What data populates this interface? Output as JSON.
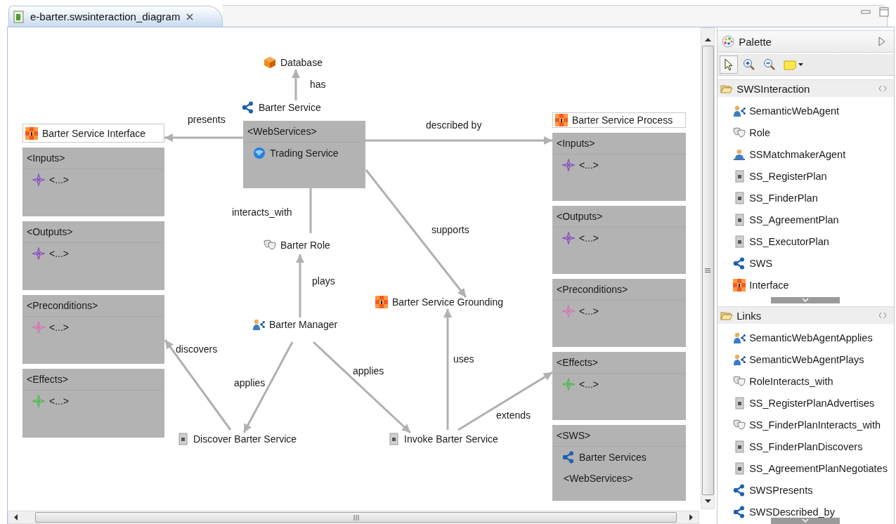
{
  "editor_tab": {
    "title": "e-barter.swsinteraction_diagram",
    "selected": true
  },
  "diagram": {
    "nodes": [
      {
        "kind": "database",
        "label": "Database"
      },
      {
        "kind": "sws",
        "label": "Barter Service"
      },
      {
        "kind": "role",
        "label": "Barter Role"
      },
      {
        "kind": "agent",
        "label": "Barter Manager"
      },
      {
        "kind": "grounding",
        "label": "Barter Service Grounding"
      },
      {
        "kind": "plan",
        "label": "Discover Barter Service"
      },
      {
        "kind": "plan",
        "label": "Invoke Barter Service"
      }
    ],
    "boxes": [
      {
        "kind": "interface",
        "title": "Barter Service Interface",
        "sections": [
          {
            "title": "<Inputs>",
            "items": [
              {
                "kind": "param",
                "label": "<...>",
                "color": "#8a4fc0"
              }
            ]
          },
          {
            "title": "<Outputs>",
            "items": [
              {
                "kind": "param",
                "label": "<...>",
                "color": "#8a4fc0"
              }
            ]
          },
          {
            "title": "<Preconditions>",
            "items": [
              {
                "kind": "param",
                "label": "<...>",
                "color": "#d774b4"
              }
            ]
          },
          {
            "title": "<Effects>",
            "items": [
              {
                "kind": "param",
                "label": "<...>",
                "color": "#4fb84f"
              }
            ]
          }
        ]
      },
      {
        "kind": "webservices",
        "sections": [
          {
            "title": "<WebServices>",
            "items": [
              {
                "kind": "globe",
                "label": "Trading Service"
              }
            ]
          }
        ]
      },
      {
        "kind": "process",
        "title": "Barter Service Process",
        "sections": [
          {
            "title": "<Inputs>",
            "items": [
              {
                "kind": "param",
                "label": "<...>",
                "color": "#8a4fc0"
              }
            ]
          },
          {
            "title": "<Outputs>",
            "items": [
              {
                "kind": "param",
                "label": "<...>",
                "color": "#8a4fc0"
              }
            ]
          },
          {
            "title": "<Preconditions>",
            "items": [
              {
                "kind": "param",
                "label": "<...>",
                "color": "#d774b4"
              }
            ]
          },
          {
            "title": "<Effects>",
            "items": [
              {
                "kind": "param",
                "label": "<...>",
                "color": "#4fb84f"
              }
            ]
          },
          {
            "title": "<SWS>",
            "items": [
              {
                "kind": "sws",
                "label": "Barter Services"
              },
              {
                "kind": "text",
                "label": "<WebServices>"
              }
            ]
          }
        ]
      }
    ],
    "edges": [
      {
        "label": "has"
      },
      {
        "label": "presents"
      },
      {
        "label": "described by"
      },
      {
        "label": "interacts_with"
      },
      {
        "label": "supports"
      },
      {
        "label": "plays"
      },
      {
        "label": "discovers"
      },
      {
        "label": "applies"
      },
      {
        "label": "applies"
      },
      {
        "label": "uses"
      },
      {
        "label": "extends"
      }
    ]
  },
  "palette": {
    "title": "Palette",
    "tools": [
      {
        "kind": "select",
        "selected": true
      },
      {
        "kind": "zoom-in",
        "selected": false
      },
      {
        "kind": "zoom-out",
        "selected": false
      },
      {
        "kind": "note",
        "selected": false
      }
    ],
    "drawers": [
      {
        "title": "SWSInteraction",
        "expanded": true,
        "items": [
          {
            "kind": "agent",
            "label": "SemanticWebAgent"
          },
          {
            "kind": "role",
            "label": "Role"
          },
          {
            "kind": "matchmaker",
            "label": "SSMatchmakerAgent"
          },
          {
            "kind": "plan",
            "label": "SS_RegisterPlan"
          },
          {
            "kind": "plan",
            "label": "SS_FinderPlan"
          },
          {
            "kind": "plan",
            "label": "SS_AgreementPlan"
          },
          {
            "kind": "plan",
            "label": "SS_ExecutorPlan"
          },
          {
            "kind": "sws",
            "label": "SWS"
          },
          {
            "kind": "interface",
            "label": "Interface"
          }
        ]
      },
      {
        "title": "Links",
        "expanded": true,
        "items": [
          {
            "kind": "agent",
            "label": "SemanticWebAgentApplies"
          },
          {
            "kind": "agent",
            "label": "SemanticWebAgentPlays"
          },
          {
            "kind": "role",
            "label": "RoleInteracts_with"
          },
          {
            "kind": "plan",
            "label": "SS_RegisterPlanAdvertises"
          },
          {
            "kind": "role",
            "label": "SS_FinderPlanInteracts_with"
          },
          {
            "kind": "plan",
            "label": "SS_FinderPlanDiscovers"
          },
          {
            "kind": "plan",
            "label": "SS_AgreementPlanNegotiates"
          },
          {
            "kind": "sws",
            "label": "SWSPresents"
          },
          {
            "kind": "sws",
            "label": "SWSDescribed_by"
          }
        ]
      }
    ]
  }
}
